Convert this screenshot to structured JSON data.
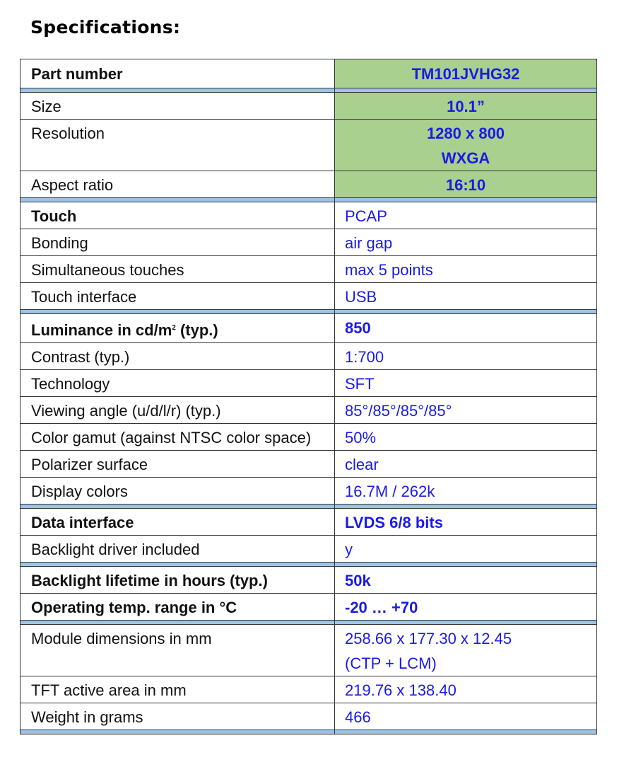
{
  "page": {
    "title": "Specifications:"
  },
  "colors": {
    "highlight_green": "#a9d08e",
    "separator_blue": "#9dc3e6",
    "value_blue": "#1a1ae6"
  },
  "spec": {
    "part_number": {
      "label": "Part number",
      "value": "TM101JVHG32"
    },
    "size": {
      "label": "Size",
      "value": "10.1”"
    },
    "resolution": {
      "label": "Resolution",
      "value_line1": "1280 x 800",
      "value_line2": "WXGA"
    },
    "aspect_ratio": {
      "label": "Aspect ratio",
      "value": "16:10"
    },
    "touch": {
      "label": "Touch",
      "value": "PCAP"
    },
    "bonding": {
      "label": "Bonding",
      "value": "air gap"
    },
    "simultaneous_touches": {
      "label": "Simultaneous touches",
      "value": "max 5 points"
    },
    "touch_interface": {
      "label": "Touch interface",
      "value": "USB"
    },
    "luminance": {
      "label_pre": "Luminance in cd/m",
      "label_sup": "2",
      "label_post": " (typ.)",
      "value": "850"
    },
    "contrast": {
      "label": "Contrast (typ.)",
      "value": "1:700"
    },
    "technology": {
      "label": "Technology",
      "value": "SFT"
    },
    "viewing_angle": {
      "label": "Viewing angle (u/d/l/r) (typ.)",
      "value": "85°/85°/85°/85°"
    },
    "color_gamut": {
      "label": "Color gamut (against NTSC color space)",
      "value": "50%"
    },
    "polarizer_surface": {
      "label": "Polarizer surface",
      "value": "clear"
    },
    "display_colors": {
      "label": "Display colors",
      "value": "16.7M / 262k"
    },
    "data_interface": {
      "label": "Data interface",
      "value": "LVDS 6/8 bits"
    },
    "backlight_driver": {
      "label": "Backlight driver included",
      "value": "y"
    },
    "backlight_lifetime": {
      "label": "Backlight lifetime in hours (typ.)",
      "value": "50k"
    },
    "operating_temp": {
      "label": "Operating temp. range in °C",
      "value": "-20 … +70"
    },
    "module_dimensions": {
      "label": "Module dimensions in mm",
      "value_line1": "258.66 x 177.30 x 12.45",
      "value_line2": "(CTP + LCM)"
    },
    "active_area": {
      "label": "TFT active area in mm",
      "value": "219.76 x 138.40"
    },
    "weight": {
      "label": "Weight in grams",
      "value": "466"
    }
  }
}
